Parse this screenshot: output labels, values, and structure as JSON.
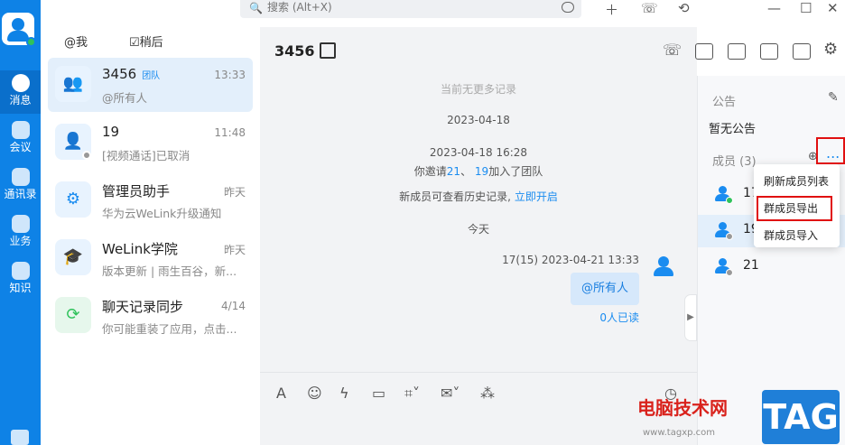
{
  "search": {
    "placeholder": "搜索 (Alt+X)"
  },
  "rail": {
    "items": [
      {
        "label": "消息"
      },
      {
        "label": "会议"
      },
      {
        "label": "通讯录"
      },
      {
        "label": "业务"
      },
      {
        "label": "知识"
      }
    ]
  },
  "filters": {
    "mentions": "@我",
    "later": "稍后"
  },
  "conversations": [
    {
      "name": "3456",
      "tag": "团队",
      "time": "13:33",
      "preview": "@所有人"
    },
    {
      "name": "19",
      "time": "11:48",
      "preview": "[视频通话]已取消"
    },
    {
      "name": "管理员助手",
      "time": "昨天",
      "preview": "华为云WeLink升级通知"
    },
    {
      "name": "WeLink学院",
      "time": "昨天",
      "preview": "版本更新 | 雨生百谷，新..."
    },
    {
      "name": "聊天记录同步",
      "time": "4/14",
      "preview": "你可能重装了应用，点击..."
    }
  ],
  "chat": {
    "title": "3456",
    "no_more": "当前无更多记录",
    "date1": "2023-04-18",
    "date2": "2023-04-18 16:28",
    "invite_prefix": "你邀请",
    "invite_a": "21",
    "invite_sep": "、 ",
    "invite_b": "19",
    "invite_suffix": "加入了团队",
    "history_prefix": "新成员可查看历史记录, ",
    "history_link": "立即开启",
    "today": "今天",
    "my_meta": "17(15)   2023-04-21 13:33",
    "my_message": "@所有人",
    "read_count": "0人已读"
  },
  "side": {
    "notice_title": "公告",
    "notice_text": "暂无公告",
    "members_title": "成员 (3)",
    "more": "...",
    "members": [
      {
        "name": "17",
        "status_color": "#2fc25b"
      },
      {
        "name": "19",
        "status_color": "#999999"
      },
      {
        "name": "21",
        "status_color": "#999999"
      }
    ]
  },
  "menu": {
    "refresh": "刷新成员列表",
    "export": "群成员导出",
    "import": "群成员导入"
  },
  "watermark": {
    "site_name": "电脑技术网",
    "url": "www.tagxp.com",
    "badge": "TAG"
  }
}
